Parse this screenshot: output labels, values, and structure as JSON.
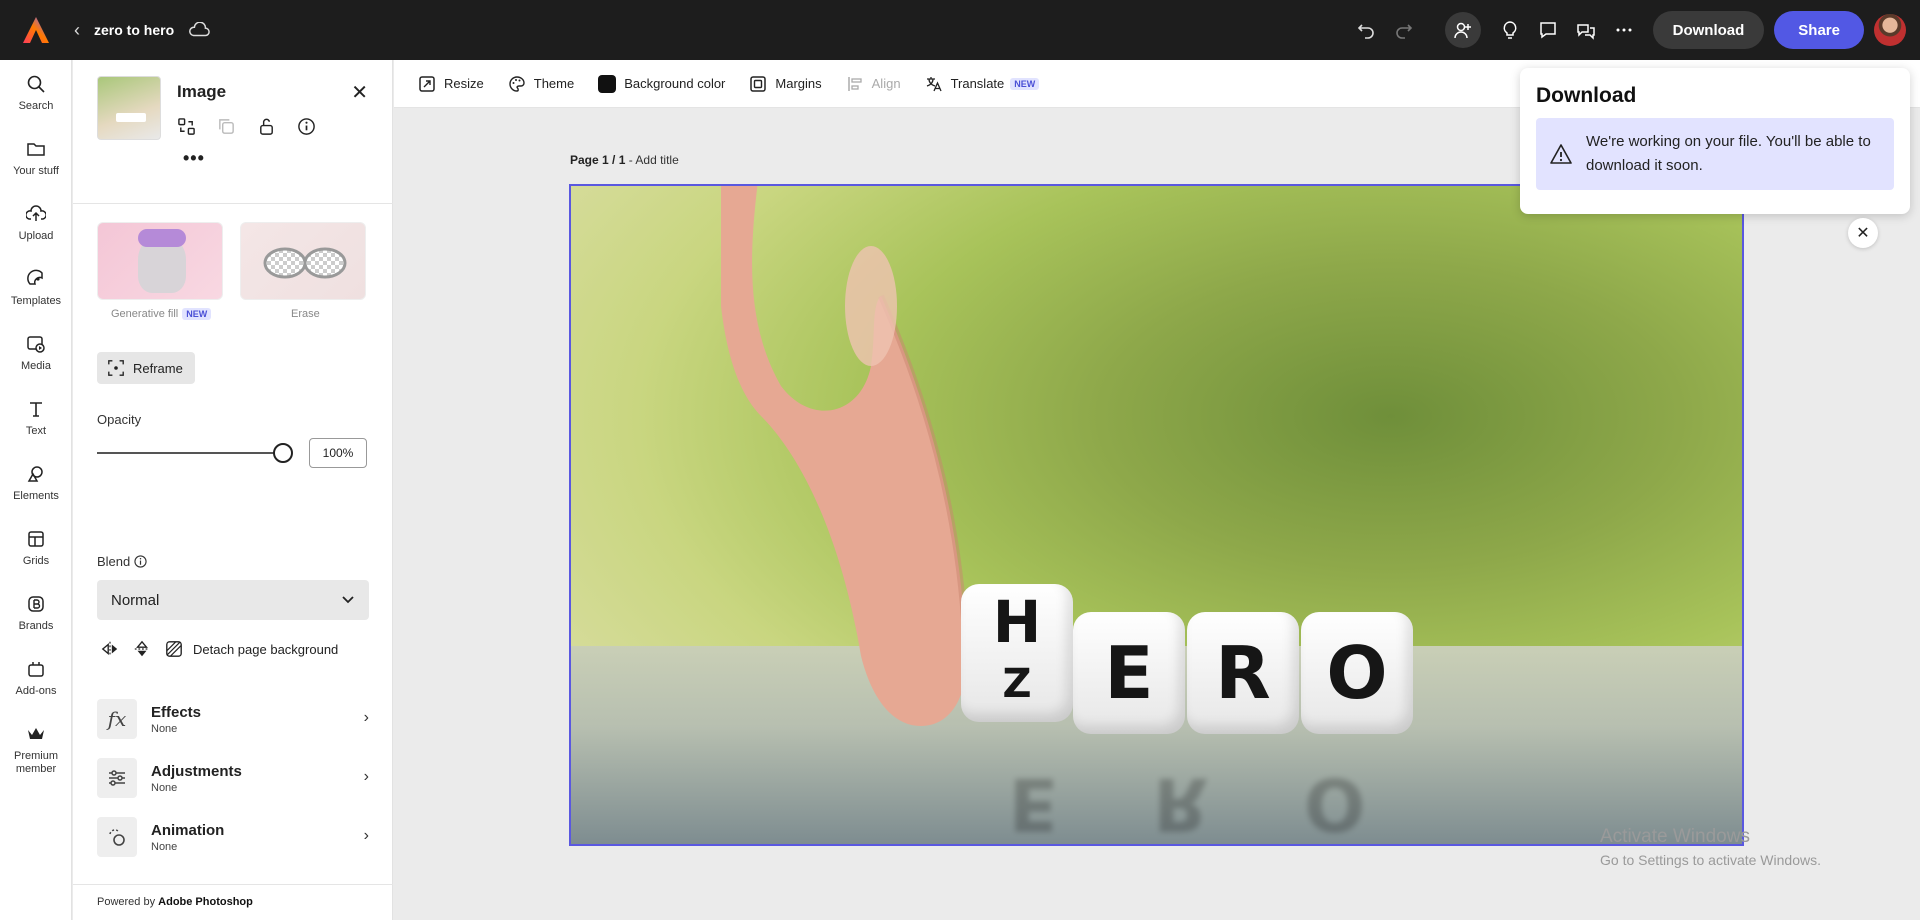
{
  "app": {
    "doc_title": "zero to hero",
    "colors": {
      "accent": "#5258e4",
      "topbar": "#1d1d1d",
      "selection": "#5a58e0",
      "notice_bg": "#e2e3ff"
    }
  },
  "topbar": {
    "icons": [
      "undo-icon",
      "redo-icon",
      "invite-icon",
      "lightbulb-icon",
      "comment-icon",
      "review-icon",
      "more-icon"
    ],
    "download_label": "Download",
    "share_label": "Share"
  },
  "rail": {
    "items": [
      {
        "label": "Search",
        "icon": "search-icon"
      },
      {
        "label": "Your stuff",
        "icon": "folder-icon"
      },
      {
        "label": "Upload",
        "icon": "upload-icon"
      },
      {
        "label": "Templates",
        "icon": "templates-icon"
      },
      {
        "label": "Media",
        "icon": "media-icon"
      },
      {
        "label": "Text",
        "icon": "text-icon"
      },
      {
        "label": "Elements",
        "icon": "elements-icon"
      },
      {
        "label": "Grids",
        "icon": "grids-icon"
      },
      {
        "label": "Brands",
        "icon": "brands-icon"
      },
      {
        "label": "Add-ons",
        "icon": "addons-icon"
      },
      {
        "label": "Premium member",
        "icon": "crown-icon"
      }
    ]
  },
  "panel": {
    "title": "Image",
    "more": "•••",
    "generative_fill_label": "Generative fill",
    "new_badge": "NEW",
    "erase_label": "Erase",
    "reframe_label": "Reframe",
    "opacity_label": "Opacity",
    "opacity_value": "100%",
    "opacity_fraction": 1.0,
    "blend_label": "Blend",
    "blend_value": "Normal",
    "detach_label": "Detach page background",
    "effects": {
      "title": "Effects",
      "value": "None"
    },
    "adjustments": {
      "title": "Adjustments",
      "value": "None"
    },
    "animation": {
      "title": "Animation",
      "value": "None"
    },
    "powered_prefix": "Powered by",
    "powered_brand": "Adobe Photoshop"
  },
  "canvas_toolbar": {
    "resize": "Resize",
    "theme": "Theme",
    "background_color": "Background color",
    "margins": "Margins",
    "align": "Align",
    "translate": "Translate",
    "translate_badge": "NEW"
  },
  "canvas": {
    "page_label": "Page 1 / 1",
    "page_sep": " - ",
    "add_title": "Add title",
    "dice": [
      "H",
      "Z",
      "E",
      "R",
      "O"
    ],
    "reflection": [
      "E",
      "R",
      "O"
    ]
  },
  "download_popover": {
    "title": "Download",
    "message": "We're working on your file. You'll be able to download it soon."
  },
  "watermark": {
    "line1": "Activate Windows",
    "line2": "Go to Settings to activate Windows."
  }
}
